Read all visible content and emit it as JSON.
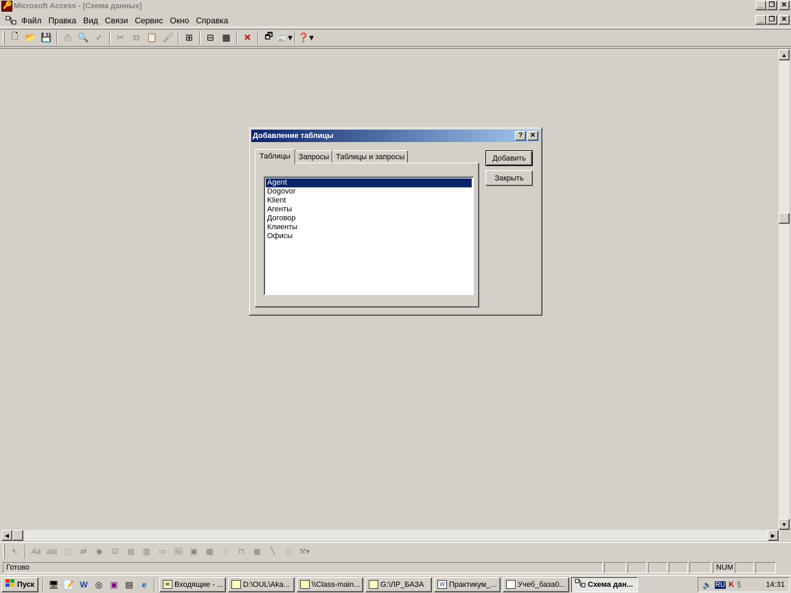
{
  "window": {
    "title": "Microsoft Access - [Схема данных]"
  },
  "menu": {
    "items": [
      "Файл",
      "Правка",
      "Вид",
      "Связи",
      "Сервис",
      "Окно",
      "Справка"
    ]
  },
  "toolbar": {
    "icons": [
      "new-icon",
      "open-icon",
      "save-icon",
      "print-icon",
      "print-preview-icon",
      "spelling-icon",
      "cut-icon",
      "copy-icon",
      "paste-icon",
      "format-painter-icon",
      "show-table-icon",
      "show-direct-icon",
      "show-all-icon",
      "delete-icon",
      "database-window-icon",
      "new-object-icon",
      "help-icon"
    ]
  },
  "dialog": {
    "title": "Добавление таблицы",
    "tabs": [
      "Таблицы",
      "Запросы",
      "Таблицы и запросы"
    ],
    "active_tab": "Таблицы",
    "list_items": [
      "Agent",
      "Dogovor",
      "Klient",
      "Агенты",
      "Договор",
      "Клиенты",
      "Офисы"
    ],
    "selected_item": "Agent",
    "add_button": "Добавить",
    "close_button": "Закрыть"
  },
  "statusbar": {
    "text": "Готово",
    "num": "NUM"
  },
  "taskbar": {
    "start_label": "Пуск",
    "tasks": [
      "Входящие - ...",
      "D:\\OUL\\Aka...",
      "\\\\Class-main...",
      "G:\\ЛР_БАЗА",
      "Практикум_...",
      "Учеб_база0...",
      "Схема дан..."
    ],
    "active_task": "Схема дан...",
    "lang": "RU",
    "clock": "14:31"
  }
}
